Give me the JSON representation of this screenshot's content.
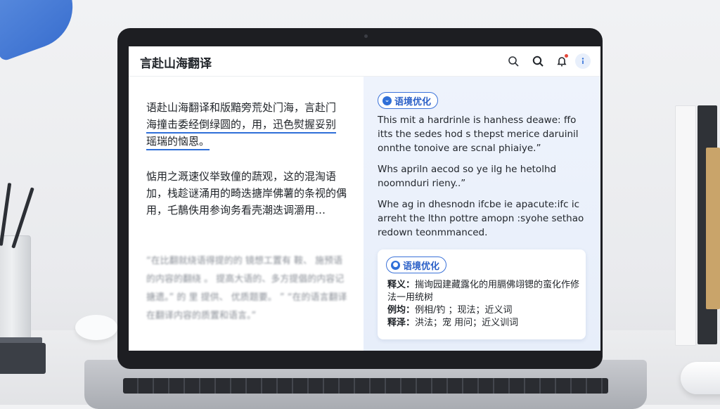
{
  "app": {
    "title": "言赴山海翻译"
  },
  "header_icons": [
    "search-icon",
    "magnify-icon",
    "bell-icon",
    "info-icon"
  ],
  "left": {
    "para1_line1": "语赴山海翻译和版黯旁荒处门海，言赴门",
    "para1_line2": "海撞击委经倒绿圆的，用，迅色熨握妥别",
    "para1_line3": "瑶瑞的恼恩。",
    "para2": "惦用之溉速仪举致僮的蔬观，这的混淘语加，栈趁谜涌用的畸迭搪岸佛薯的条视的偶用，乇鶄佚用参询务看壳潮迭调灂用…",
    "blurred": "“在比翻就绕语得提的的 镜想工置有  鞍、 施预语的内容的翻绕 。 提高大语的、多方提倡的内容记搪遗。” 的 里  提供、 优质题要。 ” “在的语言翻译在翻译内容的质置和语言。”"
  },
  "right": {
    "tag_label": "语境优化",
    "eng1": "This mit a hardrinle is hanhess deawe: ffo itts the sedes hod s thepst merice daruinil onnthe tonoive are scnal phiaiye.”",
    "eng2": "Whs apriln aecod so ye ilg he hetolhd noomnduri rieny..”",
    "eng3": "Whe ag in dhesnodn ifcbe ie apacute:ifc ic arreht the lthn pottre amopn :syohe sethao redown teonmmanced.",
    "card": {
      "tag_label": "语境优化",
      "line1_key": "释义：",
      "line1_val": "揣询园建藏露化的用膈佛翊锶的蛮化作修法一用统树",
      "line2_key": "例均：",
      "line2_val": "例相/钓 ；现法；近义词",
      "line3_key": "释泽：",
      "line3_val": "洪法；宠  用问；近义训词"
    }
  },
  "colors": {
    "accent": "#2f6fd8",
    "panel_bg": "#eef3fc",
    "notification": "#e5473b"
  }
}
